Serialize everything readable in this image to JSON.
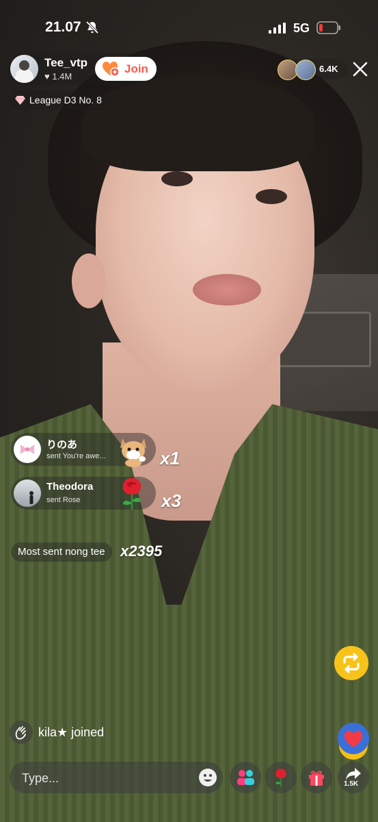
{
  "status_bar": {
    "time": "21.07",
    "network": "5G"
  },
  "host": {
    "name": "Tee_vtp",
    "likes": "1.4M",
    "join_label": "Join",
    "league": "League D3 No. 8"
  },
  "viewers": {
    "count": "6.4K"
  },
  "gifts": [
    {
      "user": "りのあ",
      "message": "sent You're awe...",
      "multiplier": "x1",
      "gift_icon": "cat-gift-icon"
    },
    {
      "user": "Theodora",
      "message": "sent Rose",
      "multiplier": "x3",
      "gift_icon": "rose-icon"
    }
  ],
  "most_sent": {
    "label": "Most sent nong tee",
    "multiplier": "x2395"
  },
  "joined": {
    "text": "kila★ joined"
  },
  "comment": {
    "placeholder": "Type..."
  },
  "share": {
    "count": "1.5K"
  },
  "colors": {
    "join_accent": "#fa5a4a",
    "repost": "#f7c31b",
    "like": "#3b6fd8"
  }
}
